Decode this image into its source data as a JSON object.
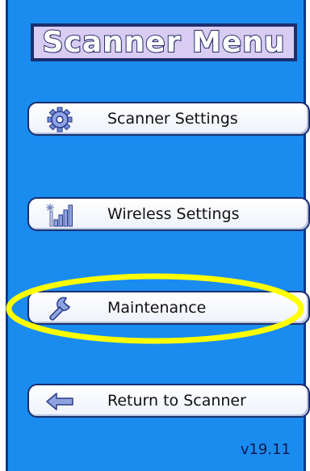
{
  "title": "Scanner Menu",
  "menu": [
    {
      "label": "Scanner Settings",
      "icon": "gear-icon"
    },
    {
      "label": "Wireless Settings",
      "icon": "signal-bars-icon"
    },
    {
      "label": "Maintenance",
      "icon": "wrench-icon"
    },
    {
      "label": "Return to Scanner",
      "icon": "left-arrow-icon"
    }
  ],
  "highlighted_item": "Maintenance",
  "highlight_color": "#ffff00",
  "background_color": "#1a8cf0",
  "title_background": "#d9ccf2",
  "version": "v19.11"
}
